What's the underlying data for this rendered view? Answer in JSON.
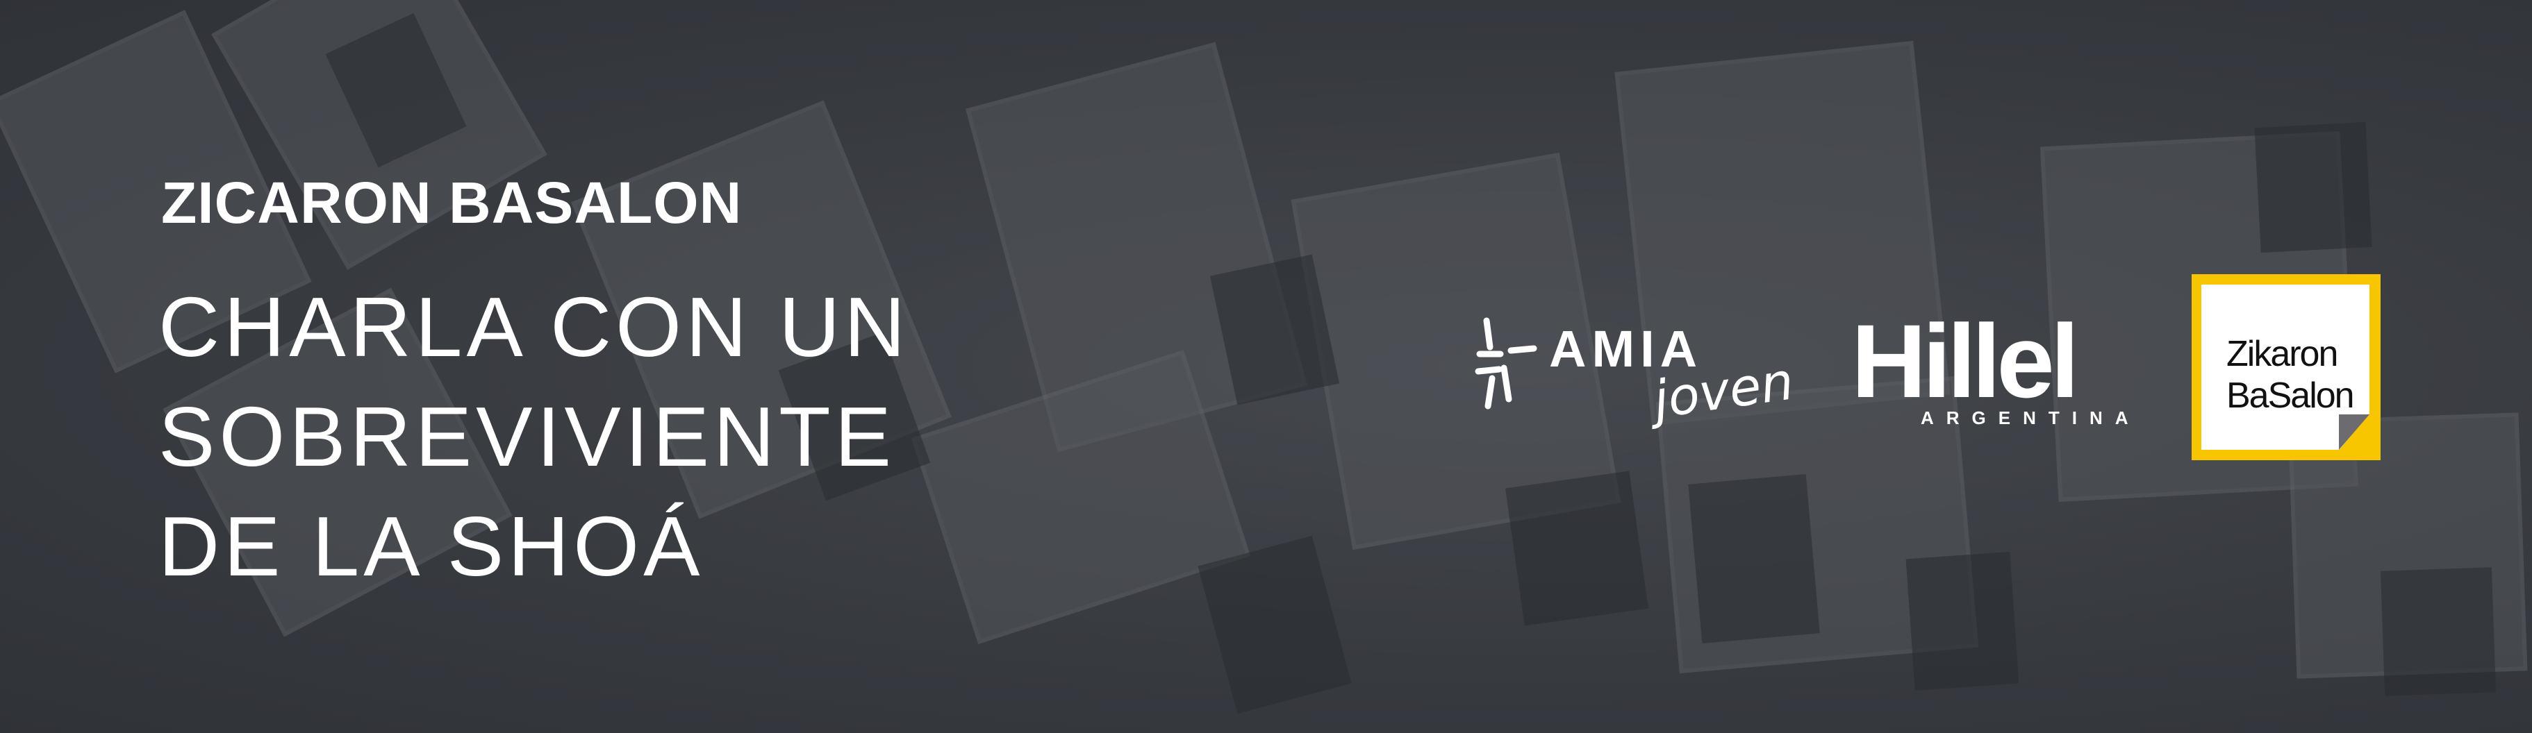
{
  "banner": {
    "kicker": "ZICARON BASALON",
    "title_lines": [
      "CHARLA CON UN",
      "SOBREVIVIENTE",
      "DE LA SHOÁ"
    ]
  },
  "logos": {
    "amia": {
      "word": "AMIA",
      "sub": "joven"
    },
    "hillel": {
      "word": "Hillel",
      "sub": "ARGENTINA"
    },
    "zikaron": {
      "line1": "Zikaron",
      "line2": "BaSalon",
      "accent": "#f7c600"
    }
  },
  "colors": {
    "background": "#45484d",
    "text": "#ffffff"
  }
}
